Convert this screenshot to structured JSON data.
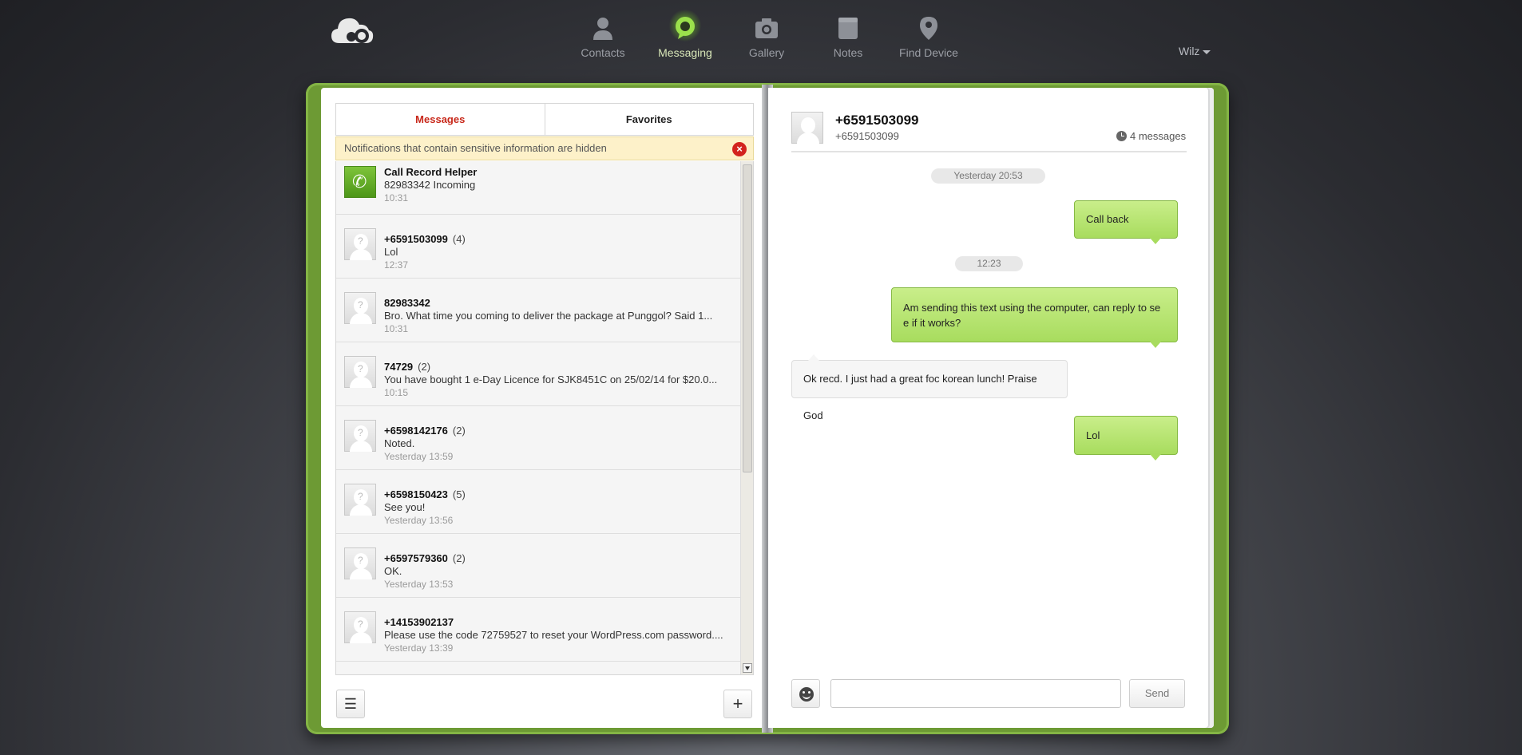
{
  "nav": {
    "items": [
      {
        "label": "Contacts",
        "icon": "contacts-icon"
      },
      {
        "label": "Messaging",
        "icon": "messaging-icon",
        "active": true
      },
      {
        "label": "Gallery",
        "icon": "camera-icon"
      },
      {
        "label": "Notes",
        "icon": "notes-icon"
      },
      {
        "label": "Find Device",
        "icon": "location-pin-icon"
      }
    ],
    "user": "Wilz"
  },
  "tabs": {
    "messages": "Messages",
    "favorites": "Favorites"
  },
  "notice": "Notifications that contain sensitive information are hidden",
  "conversations": [
    {
      "name": "Call Record Helper",
      "count": "",
      "preview": "82983342   Incoming",
      "time": "10:31"
    },
    {
      "name": "+6591503099",
      "count": "(4)",
      "preview": "Lol",
      "time": "12:37"
    },
    {
      "name": "82983342",
      "count": "",
      "preview": "Bro. What time you coming to deliver the package at Punggol? Said 1...",
      "time": "10:31"
    },
    {
      "name": "74729",
      "count": "(2)",
      "preview": "You have bought 1 e-Day Licence for SJK8451C on 25/02/14 for $20.0...",
      "time": "10:15"
    },
    {
      "name": "+6598142176",
      "count": "(2)",
      "preview": "Noted.",
      "time": "Yesterday 13:59"
    },
    {
      "name": "+6598150423",
      "count": "(5)",
      "preview": "See you!",
      "time": "Yesterday 13:56"
    },
    {
      "name": "+6597579360",
      "count": "(2)",
      "preview": "OK.",
      "time": "Yesterday 13:53"
    },
    {
      "name": "+14153902137",
      "count": "",
      "preview": "Please use the code 72759527 to reset your WordPress.com password....",
      "time": "Yesterday 13:39"
    }
  ],
  "chat": {
    "title": "+6591503099",
    "subtitle": "+6591503099",
    "count": "4 messages",
    "stamps": [
      "Yesterday 20:53",
      "12:23"
    ],
    "messages": [
      {
        "dir": "out",
        "text": "Call back"
      },
      {
        "dir": "out",
        "text": "Am sending this text using the computer, can reply to se\ne if it works?"
      },
      {
        "dir": "in",
        "text": "Ok recd. I just had a great foc korean lunch! Praise God"
      },
      {
        "dir": "out",
        "text": "Lol"
      }
    ],
    "input_placeholder": "",
    "send_label": "Send"
  },
  "colors": {
    "accent": "#a8dc5e",
    "book": "#6d9a34",
    "active_tab": "#c8281a"
  }
}
